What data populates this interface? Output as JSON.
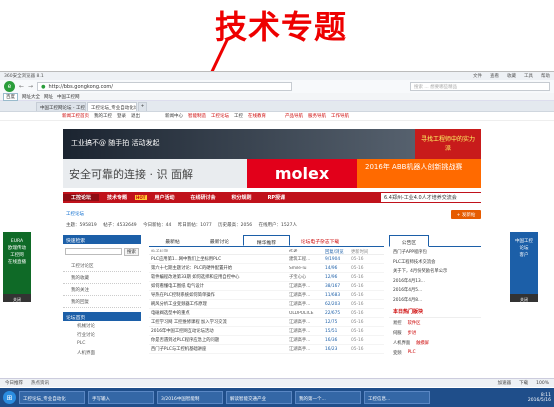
{
  "annotation": {
    "text": "技术专题"
  },
  "browser": {
    "app_title": "360安全浏览器 8.1",
    "menu": [
      "文件",
      "查看",
      "收藏",
      "工具",
      "帮助"
    ],
    "url": "http://bbs.gongkong.com/",
    "search_placeholder": "搜索 ... 想要哪些精品",
    "bookmark_items": [
      "百度",
      "网址大全",
      "网址",
      "中国工控网",
      "网址大全",
      "百度"
    ],
    "nav_back": "←",
    "nav_forward": "→",
    "logo_glyph": "e"
  },
  "tabs": [
    {
      "label": "中国工控网论坛 - 工控论坛 - 工控网"
    },
    {
      "label": "工控论坛_专业自动化论坛-中国工控网"
    },
    {
      "label": "+"
    }
  ],
  "site_top": {
    "items": [
      "新闻工控首页",
      "我的工控",
      "登录",
      "退出",
      "新闻中心",
      "智能制造",
      "工控论坛",
      "工控",
      "在线教育",
      "产品导航",
      "服务导航",
      "工作导航"
    ]
  },
  "banners": {
    "b1": "工业搞不@ 随手拍  活动发起",
    "b2": "寻找工程师中的实力派",
    "b3": "安全可靠的连接 · 识 面解",
    "b4": "molex",
    "b5": "2016年 ABB机器人创新挑战赛"
  },
  "main_nav": {
    "items": [
      "工控论坛",
      "技术专题",
      "用户活动",
      "在线研讨会",
      "积分规则",
      "RP授课"
    ],
    "hot_badge": "HOT",
    "message": "6.4郑州-工业4.0人才培养交流会"
  },
  "breadcrumb": "工控论坛",
  "post_button": "+ 发新帖",
  "stats": [
    "主题：595819",
    "帖子：4532649",
    "今日新帖：44",
    "昨日新帖：1077",
    "历史最高：2056",
    "在线用户：1527人"
  ],
  "left_panel": {
    "header1": "快速检索",
    "search_button": "搜索",
    "links": [
      "工控讨论区",
      "我的收藏",
      "我的关注",
      "我的回复"
    ],
    "header2": "论坛首页",
    "sub": [
      "机械讨论",
      "行业讨论",
      "PLC",
      "人机界面"
    ]
  },
  "center": {
    "tabs": [
      "最新帖",
      "最新讨论",
      "精华推荐",
      "论坛电子杂志下载"
    ],
    "columns": [
      "帖子标题",
      "作者",
      "回复/浏览",
      "更新时间"
    ],
    "rows": [
      {
        "title": "PLC应用第1...网中我们上坐标用PLC",
        "author": "建筑工程...",
        "replies": "9/1904",
        "time": "05-16"
      },
      {
        "title": "第六十七期主题讨论：PLC的硬件配置开始",
        "author": "Smile-lu",
        "replies": "14/96",
        "time": "05-16"
      },
      {
        "title": "软件编程改进第33期 如何选择和应用自控中心",
        "author": "子宝心心",
        "replies": "12/96",
        "time": "05-16"
      },
      {
        "title": "如何看懂电工图纸 电气设计",
        "author": "江湖高手...",
        "replies": "38/167",
        "time": "05-16"
      },
      {
        "title": "导热在PLC控制系统如何简单操作",
        "author": "江湖高手...",
        "replies": "11/683",
        "time": "05-16"
      },
      {
        "title": "刷风分析工业变频器工作原理",
        "author": "江湖高手...",
        "replies": "62/203",
        "time": "05-16"
      },
      {
        "title": "电磁阀选型中的重点",
        "author": "OLDPOLICE",
        "replies": "22/675",
        "time": "05-16"
      },
      {
        "title": "工控学习网 工控维修课程 加入学习交流",
        "author": "江湖高手...",
        "replies": "12/75",
        "time": "05-16"
      },
      {
        "title": "2016年中国工控网互动论坛活动",
        "author": "江湖高手...",
        "replies": "15/51",
        "time": "05-16"
      },
      {
        "title": "你是否遇到过PLC程序应急上的问题",
        "author": "江湖高手...",
        "replies": "16/36",
        "time": "05-16"
      },
      {
        "title": "西门子PLC与工控机基础讲座",
        "author": "江湖高手...",
        "replies": "16/23",
        "time": "05-16"
      }
    ]
  },
  "right_panel": {
    "tab": "公告区",
    "notices": [
      "西门子APP程序包",
      "PLC工程师技术交流会",
      "关于下，4月份奖励名单公示",
      "2016年4月13...",
      "2016年4月5...",
      "2016年4月8..."
    ],
    "header2": "本日热门版块",
    "sections": [
      {
        "label": "易控",
        "value": "软件区"
      },
      {
        "label": "伺服",
        "value": "步进"
      },
      {
        "label": "人机界面",
        "value": "触摸屏"
      },
      {
        "label": "变频",
        "value": "PLC"
      }
    ]
  },
  "ads": {
    "left_lines": [
      "EURA",
      "欧瑞传动",
      "工控网",
      "在线直播"
    ],
    "left_close": "关闭",
    "right_lines": [
      "中国工控",
      "论坛",
      "客户"
    ],
    "right_close": "关闭"
  },
  "status": {
    "left": "今日推荐",
    "hotspot": "热点资讯",
    "items": [
      "加速器",
      "下载",
      "100%"
    ]
  },
  "taskbar": {
    "start_glyph": "⊞",
    "items": [
      "工控论坛_专业自动化",
      "手写输入",
      "3/2016中国智能制",
      "解读智能交通产业",
      "我的第一个...",
      "工控信息..."
    ],
    "time": "8:11",
    "date": "2016/5/16"
  }
}
